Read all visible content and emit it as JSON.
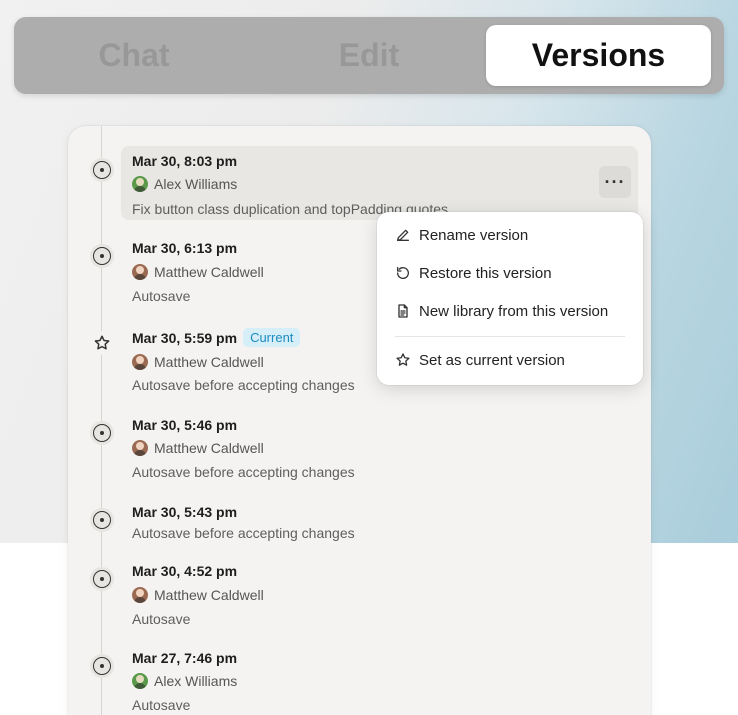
{
  "tabs": [
    {
      "label": "Chat",
      "active": false
    },
    {
      "label": "Edit",
      "active": false
    },
    {
      "label": "Versions",
      "active": true
    }
  ],
  "versions": [
    {
      "time": "Mar 30, 8:03 pm",
      "author": "Alex Williams",
      "avatar": "green",
      "desc": "Fix button class duplication and topPadding quotes",
      "badge": "",
      "icon": "circle-dot-icon"
    },
    {
      "time": "Mar 30, 6:13 pm",
      "author": "Matthew Caldwell",
      "avatar": "brown",
      "desc": "Autosave",
      "badge": "",
      "icon": "circle-dot-icon"
    },
    {
      "time": "Mar 30, 5:59 pm",
      "author": "Matthew Caldwell",
      "avatar": "brown",
      "desc": "Autosave before accepting changes",
      "badge": "Current",
      "icon": "star-icon"
    },
    {
      "time": "Mar 30, 5:46 pm",
      "author": "Matthew Caldwell",
      "avatar": "brown",
      "desc": "Autosave before accepting changes",
      "badge": "",
      "icon": "circle-dot-icon"
    },
    {
      "time": "Mar 30, 5:43 pm",
      "author": "",
      "avatar": "",
      "desc": "Autosave before accepting changes",
      "badge": "",
      "icon": "circle-dot-icon"
    },
    {
      "time": "Mar 30, 4:52 pm",
      "author": "Matthew Caldwell",
      "avatar": "brown",
      "desc": "Autosave",
      "badge": "",
      "icon": "circle-dot-icon"
    },
    {
      "time": "Mar 27, 7:46 pm",
      "author": "Alex Williams",
      "avatar": "green",
      "desc": "Autosave",
      "badge": "",
      "icon": "circle-dot-icon"
    }
  ],
  "more_button": {
    "label": "···",
    "icon": "more-horizontal-icon"
  },
  "menu": {
    "items": [
      {
        "label": "Rename version",
        "icon": "pencil-icon"
      },
      {
        "label": "Restore this version",
        "icon": "restore-icon"
      },
      {
        "label": "New library from this version",
        "icon": "document-icon"
      },
      {
        "label": "Set as current version",
        "icon": "star-icon"
      }
    ]
  },
  "colors": {
    "accent_badge_text": "#1b8bc0",
    "accent_badge_bg": "#d6eef8",
    "panel_bg": "#f4f3f1",
    "tabbar_bg": "#adadad"
  }
}
